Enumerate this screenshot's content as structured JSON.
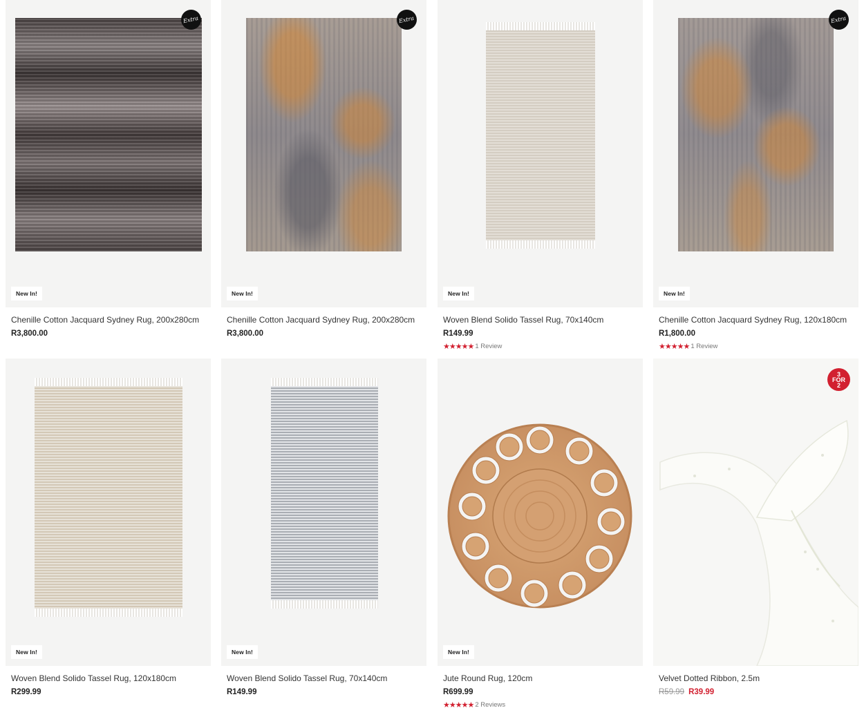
{
  "products": [
    {
      "title": "Chenille Cotton Jacquard Sydney Rug, 200x280cm",
      "price": "R3,800.00",
      "badge": "New In!",
      "corner_badge": "Extra",
      "image": "dark-abstract-rug"
    },
    {
      "title": "Chenille Cotton Jacquard Sydney Rug, 200x280cm",
      "price": "R3,800.00",
      "badge": "New In!",
      "corner_badge": "Extra",
      "image": "rust-grey-abstract-rug"
    },
    {
      "title": "Woven Blend Solido Tassel Rug, 70x140cm",
      "price": "R149.99",
      "badge": "New In!",
      "rating": {
        "stars": "★★★★★",
        "text": "1 Review"
      },
      "image": "beige-striped-tassel-rug"
    },
    {
      "title": "Chenille Cotton Jacquard Sydney Rug, 120x180cm",
      "price": "R1,800.00",
      "badge": "New In!",
      "corner_badge": "Extra",
      "rating": {
        "stars": "★★★★★",
        "text": "1 Review"
      },
      "image": "rust-grey-abstract-rug"
    },
    {
      "title": "Woven Blend Solido Tassel Rug, 120x180cm",
      "price": "R299.99",
      "badge": "New In!",
      "image": "cream-striped-tassel-rug"
    },
    {
      "title": "Woven Blend Solido Tassel Rug, 70x140cm",
      "price": "R149.99",
      "badge": "New In!",
      "image": "grey-striped-tassel-rug"
    },
    {
      "title": "Jute Round Rug, 120cm",
      "price": "R699.99",
      "badge": "New In!",
      "rating": {
        "stars": "★★★★★",
        "text": "2 Reviews"
      },
      "image": "jute-round-rug"
    },
    {
      "title": "Velvet Dotted Ribbon, 2.5m",
      "was_price": "R59.99",
      "sale_price": "R39.99",
      "promo_badge": {
        "line1": "3",
        "line2": "FOR",
        "line3": "2"
      },
      "image": "white-ribbon-bow"
    }
  ],
  "colors": {
    "accent_red": "#d22030",
    "thumb_bg": "#f4f4f3",
    "text": "#333333",
    "muted": "#999999"
  }
}
